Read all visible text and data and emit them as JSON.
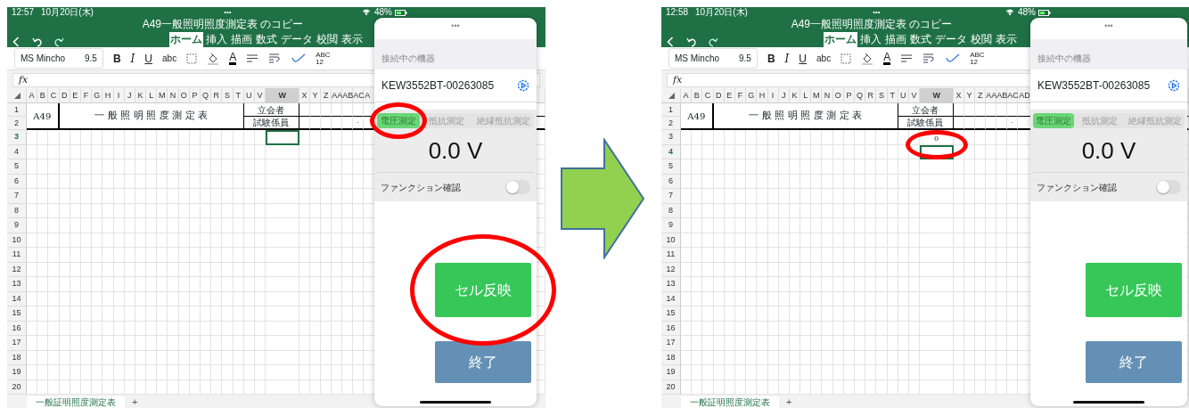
{
  "screens": [
    {
      "status_bar": {
        "time": "12:57",
        "date": "10月20日(木)",
        "handle": "•••",
        "battery": "48%"
      },
      "title": "A49一般照明照度測定表 のコピー",
      "ribbon_tabs": [
        {
          "label": "ホーム",
          "selected": true
        },
        {
          "label": "挿入",
          "selected": false
        },
        {
          "label": "描画",
          "selected": false
        },
        {
          "label": "数式",
          "selected": false
        },
        {
          "label": "データ",
          "selected": false
        },
        {
          "label": "校閲",
          "selected": false
        },
        {
          "label": "表示",
          "selected": false
        }
      ],
      "toolbar": {
        "font_name": "MS Mincho",
        "font_size": "9.5",
        "buttons": [
          {
            "kind": "bold",
            "label": "B"
          },
          {
            "kind": "italic",
            "label": "I"
          },
          {
            "kind": "underline",
            "label": "U"
          },
          {
            "kind": "strike",
            "label": "abc"
          },
          {
            "kind": "borders"
          },
          {
            "kind": "fill"
          },
          {
            "kind": "font_color",
            "label": "A"
          },
          {
            "kind": "align"
          },
          {
            "kind": "wrap"
          },
          {
            "kind": "brush"
          },
          {
            "kind": "number",
            "label": "ABC",
            "sublabel": "12"
          }
        ]
      },
      "formula_label": "fx",
      "columns": [
        {
          "label": "A",
          "selected": false
        },
        {
          "label": "B",
          "selected": false
        },
        {
          "label": "C",
          "selected": false
        },
        {
          "label": "D",
          "selected": false
        },
        {
          "label": "E",
          "selected": false
        },
        {
          "label": "F",
          "selected": false
        },
        {
          "label": "G",
          "selected": false
        },
        {
          "label": "H",
          "selected": false
        },
        {
          "label": "I",
          "selected": false
        },
        {
          "label": "J",
          "selected": false
        },
        {
          "label": "K",
          "selected": false
        },
        {
          "label": "L",
          "selected": false
        },
        {
          "label": "M",
          "selected": false
        },
        {
          "label": "N",
          "selected": false
        },
        {
          "label": "O",
          "selected": false
        },
        {
          "label": "P",
          "selected": false
        },
        {
          "label": "Q",
          "selected": false
        },
        {
          "label": "R",
          "selected": false
        },
        {
          "label": "S",
          "selected": false
        },
        {
          "label": "T",
          "selected": false
        },
        {
          "label": "U",
          "selected": false
        },
        {
          "label": "V",
          "selected": false
        },
        {
          "label": "W",
          "selected": true
        },
        {
          "label": "X",
          "selected": false
        },
        {
          "label": "Y",
          "selected": false
        },
        {
          "label": "Z",
          "selected": false
        },
        {
          "label": "AA",
          "selected": false
        },
        {
          "label": "AB",
          "selected": false
        },
        {
          "label": "AC",
          "selected": false
        },
        {
          "label": "A",
          "selected": false
        }
      ],
      "rows": [
        {
          "label": "1",
          "selected": false
        },
        {
          "label": "2",
          "selected": false
        },
        {
          "label": "3",
          "selected": true
        },
        {
          "label": "4",
          "selected": false
        },
        {
          "label": "5",
          "selected": false
        },
        {
          "label": "6",
          "selected": false
        },
        {
          "label": "7",
          "selected": false
        },
        {
          "label": "8",
          "selected": false
        },
        {
          "label": "9",
          "selected": false
        },
        {
          "label": "10",
          "selected": false
        },
        {
          "label": "11",
          "selected": false
        },
        {
          "label": "12",
          "selected": false
        },
        {
          "label": "13",
          "selected": false
        },
        {
          "label": "14",
          "selected": false
        },
        {
          "label": "15",
          "selected": false
        },
        {
          "label": "16",
          "selected": false
        },
        {
          "label": "17",
          "selected": false
        },
        {
          "label": "18",
          "selected": false
        },
        {
          "label": "19",
          "selected": false
        },
        {
          "label": "20",
          "selected": false
        }
      ],
      "selection_circled": false,
      "header_block": {
        "code": "A49",
        "title": "一 般 照 明 照 度 測 定 表",
        "role_1": "立会者",
        "role_2": "試験係員",
        "mark": "."
      },
      "sheet_tabs": [
        {
          "label": "一般証明照度測定表",
          "selected": true
        }
      ],
      "add_sheet": "+",
      "panel": {
        "handle": "•••",
        "section_label": "接続中の機器",
        "device": "KEW3552BT-00263085",
        "modes": [
          {
            "label": "電圧測定",
            "selected": true
          },
          {
            "label": "抵抗測定",
            "selected": false
          },
          {
            "label": "絶縁抵抗測定",
            "selected": false
          }
        ],
        "selected_mode_circled": true,
        "reading": "0.0 V",
        "function_check": {
          "label": "ファンクション確認",
          "on": false
        },
        "apply_button": "セル反映",
        "apply_button_circled": true,
        "end_button": "終了"
      }
    },
    {
      "status_bar": {
        "time": "12:58",
        "date": "10月20日(木)",
        "handle": "•••",
        "battery": "48%"
      },
      "title": "A49一般照明照度測定表 のコピー",
      "ribbon_tabs": [
        {
          "label": "ホーム",
          "selected": true
        },
        {
          "label": "挿入",
          "selected": false
        },
        {
          "label": "描画",
          "selected": false
        },
        {
          "label": "数式",
          "selected": false
        },
        {
          "label": "データ",
          "selected": false
        },
        {
          "label": "校閲",
          "selected": false
        },
        {
          "label": "表示",
          "selected": false
        }
      ],
      "toolbar": {
        "font_name": "MS Mincho",
        "font_size": "9.5",
        "buttons": [
          {
            "kind": "bold",
            "label": "B"
          },
          {
            "kind": "italic",
            "label": "I"
          },
          {
            "kind": "underline",
            "label": "U"
          },
          {
            "kind": "strike",
            "label": "abc"
          },
          {
            "kind": "borders"
          },
          {
            "kind": "fill"
          },
          {
            "kind": "font_color",
            "label": "A"
          },
          {
            "kind": "align"
          },
          {
            "kind": "wrap"
          },
          {
            "kind": "brush"
          },
          {
            "kind": "number",
            "label": "ABC",
            "sublabel": "12"
          }
        ]
      },
      "formula_label": "fx",
      "columns": [
        {
          "label": "A",
          "selected": false
        },
        {
          "label": "B",
          "selected": false
        },
        {
          "label": "C",
          "selected": false
        },
        {
          "label": "D",
          "selected": false
        },
        {
          "label": "E",
          "selected": false
        },
        {
          "label": "F",
          "selected": false
        },
        {
          "label": "G",
          "selected": false
        },
        {
          "label": "H",
          "selected": false
        },
        {
          "label": "I",
          "selected": false
        },
        {
          "label": "J",
          "selected": false
        },
        {
          "label": "K",
          "selected": false
        },
        {
          "label": "L",
          "selected": false
        },
        {
          "label": "M",
          "selected": false
        },
        {
          "label": "N",
          "selected": false
        },
        {
          "label": "O",
          "selected": false
        },
        {
          "label": "P",
          "selected": false
        },
        {
          "label": "Q",
          "selected": false
        },
        {
          "label": "R",
          "selected": false
        },
        {
          "label": "S",
          "selected": false
        },
        {
          "label": "T",
          "selected": false
        },
        {
          "label": "U",
          "selected": false
        },
        {
          "label": "V",
          "selected": false
        },
        {
          "label": "W",
          "selected": true
        },
        {
          "label": "X",
          "selected": false
        },
        {
          "label": "Y",
          "selected": false
        },
        {
          "label": "Z",
          "selected": false
        },
        {
          "label": "AA",
          "selected": false
        },
        {
          "label": "AB",
          "selected": false
        },
        {
          "label": "AC",
          "selected": false
        },
        {
          "label": "AD",
          "selected": false
        }
      ],
      "rows": [
        {
          "label": "1",
          "selected": false
        },
        {
          "label": "2",
          "selected": false
        },
        {
          "label": "3",
          "selected": false,
          "value": "0"
        },
        {
          "label": "4",
          "selected": true
        },
        {
          "label": "5",
          "selected": false
        },
        {
          "label": "6",
          "selected": false
        },
        {
          "label": "7",
          "selected": false
        },
        {
          "label": "8",
          "selected": false
        },
        {
          "label": "9",
          "selected": false
        },
        {
          "label": "10",
          "selected": false
        },
        {
          "label": "11",
          "selected": false
        },
        {
          "label": "12",
          "selected": false
        },
        {
          "label": "13",
          "selected": false
        },
        {
          "label": "14",
          "selected": false
        },
        {
          "label": "15",
          "selected": false
        },
        {
          "label": "16",
          "selected": false
        },
        {
          "label": "17",
          "selected": false
        },
        {
          "label": "18",
          "selected": false
        },
        {
          "label": "19",
          "selected": false
        },
        {
          "label": "20",
          "selected": false
        }
      ],
      "selection_circled": true,
      "header_block": {
        "code": "A49",
        "title": "一 般 照 明 照 度 測 定 表",
        "role_1": "立会者",
        "role_2": "試験係員",
        "mark": "."
      },
      "sheet_tabs": [
        {
          "label": "一般証明照度測定表",
          "selected": true
        }
      ],
      "add_sheet": "+",
      "panel": {
        "handle": "•••",
        "section_label": "接続中の機器",
        "device": "KEW3552BT-00263085",
        "modes": [
          {
            "label": "電圧測定",
            "selected": true
          },
          {
            "label": "抵抗測定",
            "selected": false
          },
          {
            "label": "絶縁抵抗測定",
            "selected": false
          }
        ],
        "selected_mode_circled": false,
        "reading": "0.0 V",
        "function_check": {
          "label": "ファンクション確認",
          "on": false
        },
        "apply_button": "セル反映",
        "apply_button_circled": false,
        "end_button": "終了"
      }
    }
  ]
}
